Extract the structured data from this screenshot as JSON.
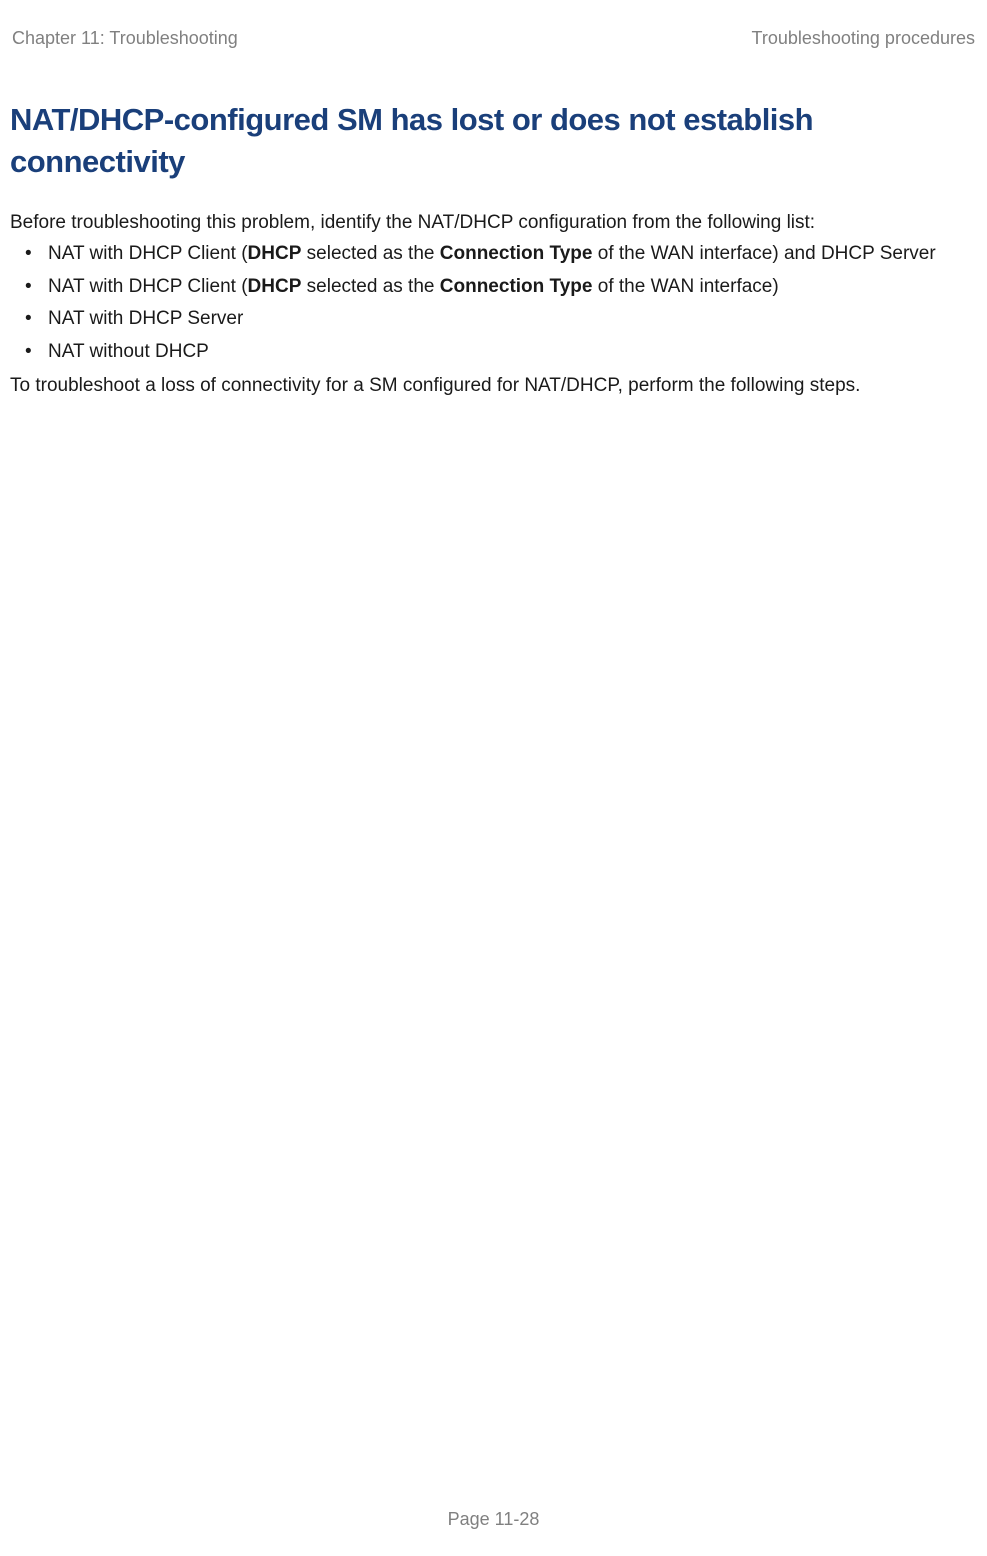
{
  "header": {
    "left": "Chapter 11:  Troubleshooting",
    "right": "Troubleshooting procedures"
  },
  "title": "NAT/DHCP-configured SM has lost or does not establish connectivity",
  "intro": "Before troubleshooting this problem, identify the NAT/DHCP configuration from the following list:",
  "li1_p1": "NAT with DHCP Client (",
  "li1_b1": "DHCP",
  "li1_p2": " selected as the ",
  "li1_b2": "Connection Type",
  "li1_p3": " of the WAN interface) and DHCP Server",
  "li2_p1": "NAT with DHCP Client (",
  "li2_b1": "DHCP",
  "li2_p2": " selected as the ",
  "li2_b2": "Connection Type",
  "li2_p3": " of the WAN interface)",
  "li3": "NAT with DHCP Server",
  "li4": "NAT without DHCP",
  "outro": "To troubleshoot a loss of connectivity for a SM configured for NAT/DHCP, perform the following steps.",
  "footer": "Page 11-28"
}
